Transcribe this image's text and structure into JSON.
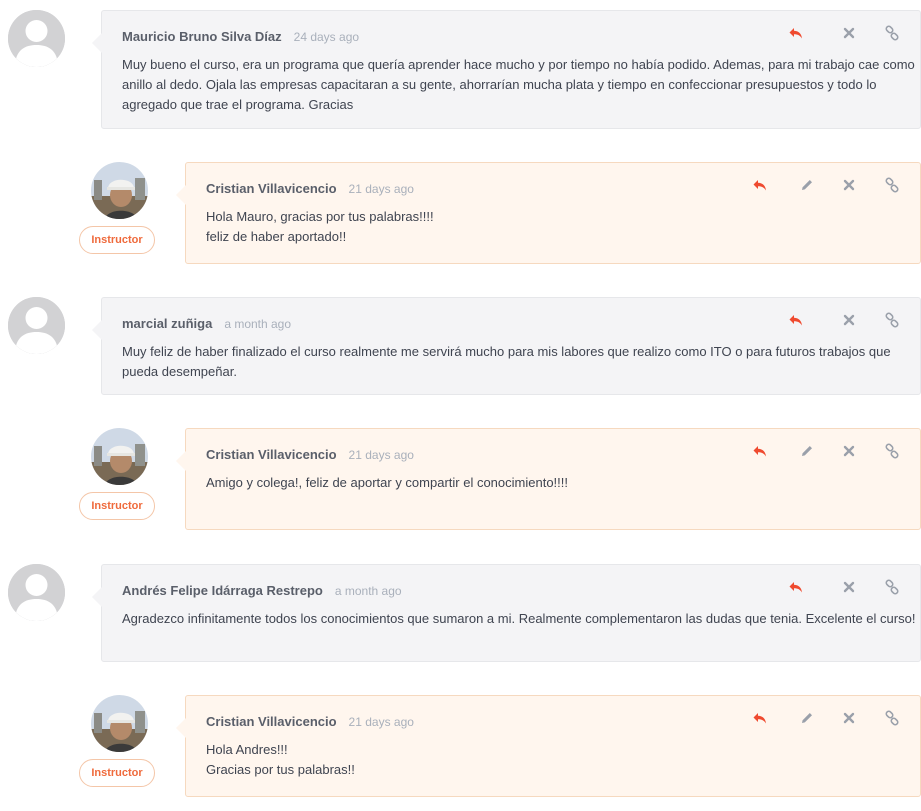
{
  "colors": {
    "accent": "#ef6a3c",
    "student_bg": "#f4f4f6",
    "instructor_bg": "#fff6ee"
  },
  "icons": {
    "reply": "reply-arrow-icon",
    "edit": "pencil-icon",
    "delete": "close-icon",
    "link": "link-icon"
  },
  "threads": [
    {
      "comment": {
        "author": "Mauricio Bruno Silva Díaz",
        "time": "24 days ago",
        "lines": [
          "Muy bueno el curso, era un programa que quería aprender hace mucho y por tiempo no había podido. Ademas, para mi trabajo cae como anillo al dedo. Ojala las empresas capacitaran a su gente, ahorrarían mucha plata y tiempo en confeccionar presupuestos y todo lo agregado que trae el programa. Gracias"
        ]
      },
      "reply": {
        "author": "Cristian Villavicencio",
        "time": "21 days ago",
        "badge": "Instructor",
        "lines": [
          "Hola Mauro, gracias por tus palabras!!!!",
          "feliz de haber aportado!!"
        ]
      }
    },
    {
      "comment": {
        "author": "marcial zuñiga",
        "time": "a month ago",
        "lines": [
          "Muy feliz de haber finalizado el curso realmente me servirá mucho para mis labores que realizo como ITO o para futuros trabajos que pueda desempeñar."
        ]
      },
      "reply": {
        "author": "Cristian Villavicencio",
        "time": "21 days ago",
        "badge": "Instructor",
        "lines": [
          "Amigo y colega!, feliz de aportar y compartir el conocimiento!!!!"
        ]
      }
    },
    {
      "comment": {
        "author": "Andrés Felipe Idárraga Restrepo",
        "time": "a month ago",
        "lines": [
          "Agradezco infinitamente todos los conocimientos que sumaron a mi. Realmente  complementaron las dudas que tenia. Excelente el curso!"
        ]
      },
      "reply": {
        "author": "Cristian Villavicencio",
        "time": "21 days ago",
        "badge": "Instructor",
        "lines": [
          "Hola Andres!!!",
          "Gracias por tus palabras!!"
        ]
      }
    }
  ]
}
